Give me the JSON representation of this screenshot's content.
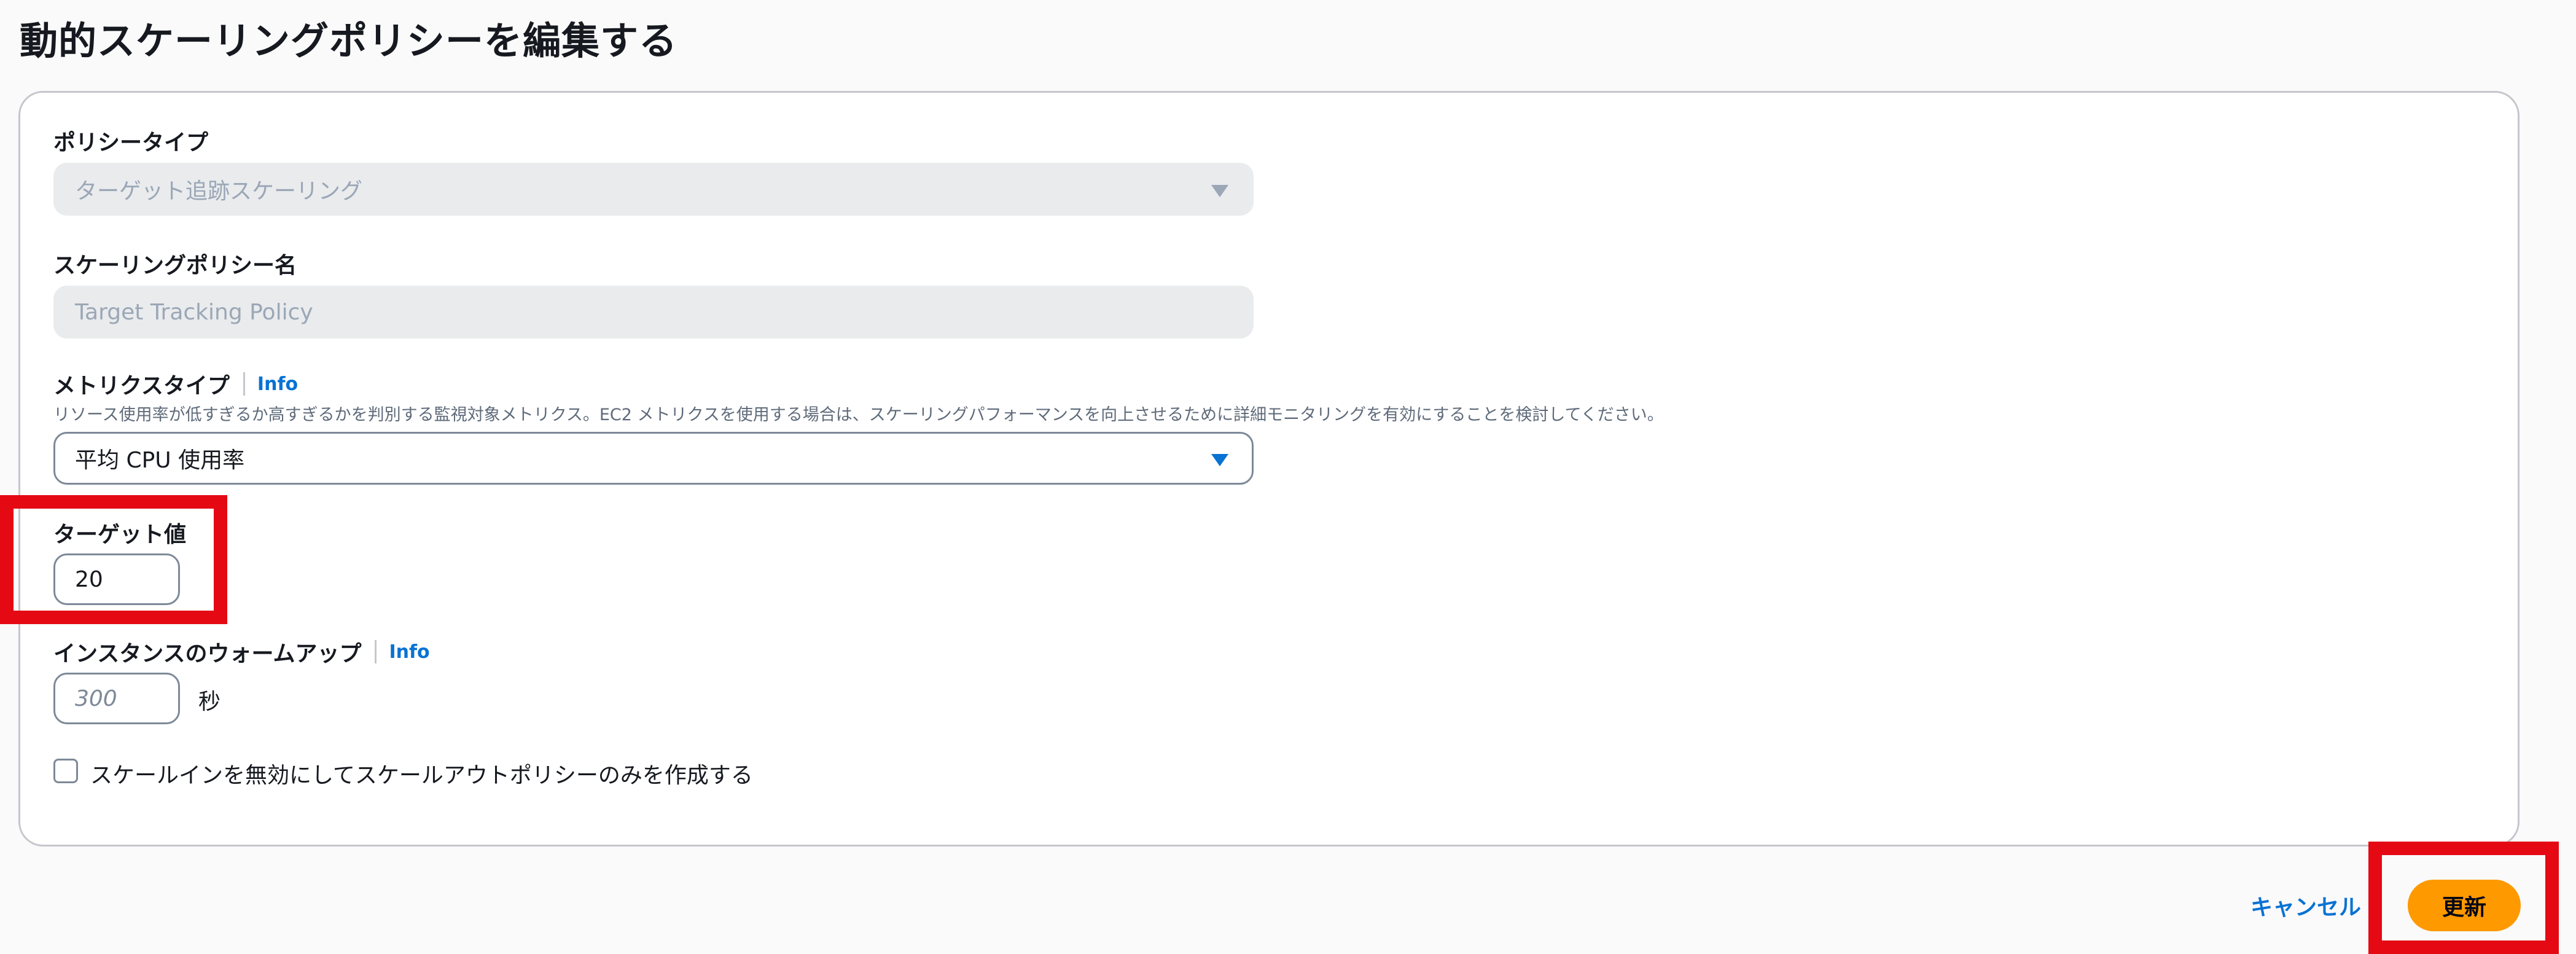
{
  "page": {
    "title": "動的スケーリングポリシーを編集する"
  },
  "form": {
    "policy_type": {
      "label": "ポリシータイプ",
      "value": "ターゲット追跡スケーリング"
    },
    "policy_name": {
      "label": "スケーリングポリシー名",
      "value": "Target Tracking Policy"
    },
    "metric_type": {
      "label": "メトリクスタイプ",
      "info": "Info",
      "description": "リソース使用率が低すぎるか高すぎるかを判別する監視対象メトリクス。EC2 メトリクスを使用する場合は、スケーリングパフォーマンスを向上させるために詳細モニタリングを有効にすることを検討してください。",
      "value": "平均 CPU 使用率"
    },
    "target_value": {
      "label": "ターゲット値",
      "value": "20"
    },
    "warmup": {
      "label": "インスタンスのウォームアップ",
      "info": "Info",
      "placeholder": "300",
      "unit": "秒"
    },
    "disable_scale_in": {
      "label": "スケールインを無効にしてスケールアウトポリシーのみを作成する",
      "checked": false
    }
  },
  "actions": {
    "cancel_label": "キャンセル",
    "update_label": "更新"
  },
  "colors": {
    "highlight": "#e50914",
    "primary_button": "#ff9900",
    "link": "#0972d3"
  }
}
